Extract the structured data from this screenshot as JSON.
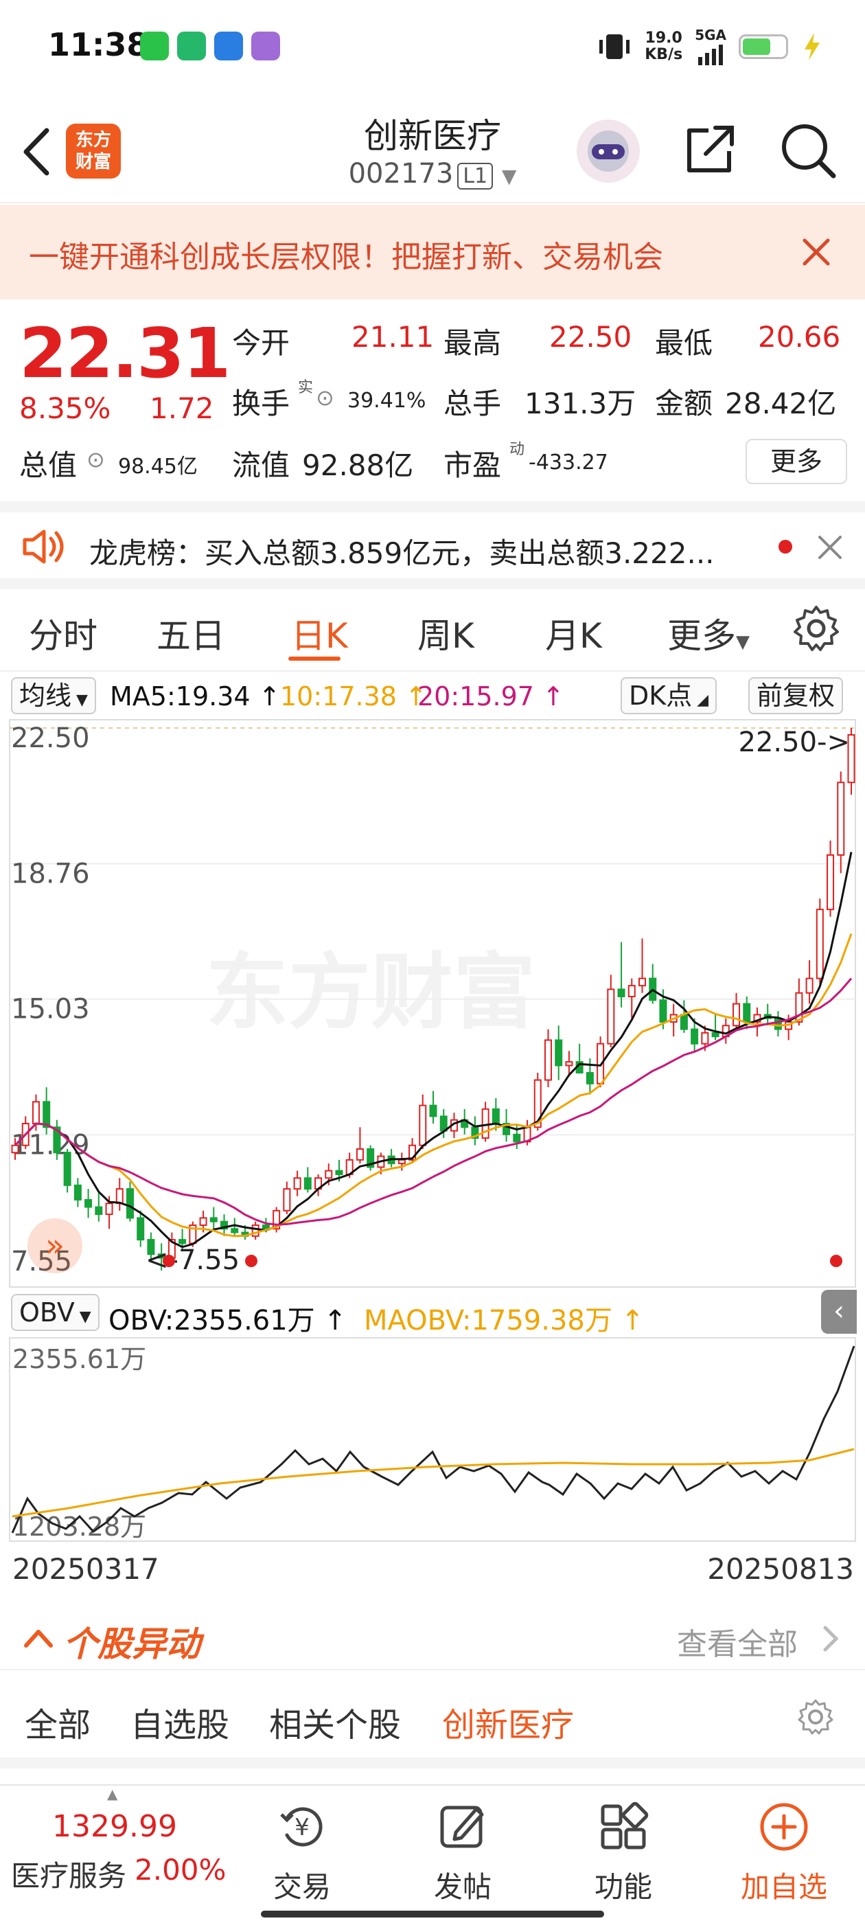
{
  "status_bar": {
    "time": "11:38",
    "net_speed": "19.0",
    "net_unit": "KB/s",
    "network": "5GA"
  },
  "header": {
    "stock_name": "创新医疗",
    "stock_code": "002173",
    "level_badge": "L1",
    "logo_line1": "东方",
    "logo_line2": "财富"
  },
  "promo": {
    "text": "一键开通科创成长层权限！把握打新、交易机会"
  },
  "quote": {
    "price": "22.31",
    "change_pct": "8.35%",
    "change": "1.72",
    "open_label": "今开",
    "open": "21.11",
    "high_label": "最高",
    "high": "22.50",
    "low_label": "最低",
    "low": "20.66",
    "turnover_label": "换手",
    "turnover_sup": "实",
    "turnover": "39.41%",
    "volume_label": "总手",
    "volume": "131.3万",
    "amount_label": "金额",
    "amount": "28.42亿",
    "mktcap_label": "总值",
    "mktcap": "98.45亿",
    "float_label": "流值",
    "float_cap": "92.88亿",
    "pe_label": "市盈",
    "pe_sup": "动",
    "pe": "-433.27",
    "more_label": "更多"
  },
  "dragon_tiger": {
    "text": "龙虎榜：买入总额3.859亿元，卖出总额3.222..."
  },
  "period_tabs": [
    "分时",
    "五日",
    "日K",
    "周K",
    "月K",
    "更多"
  ],
  "ma_row": {
    "selector": "均线",
    "ma5": "MA5:19.34",
    "ma10": "10:17.38",
    "ma20": "20:15.97",
    "dk": "DK点",
    "adjust": "前复权"
  },
  "kline": {
    "y_labels": [
      "22.50",
      "18.76",
      "15.03",
      "11.29",
      "7.55"
    ],
    "max_marker": "22.50->",
    "min_marker": "<-7.55",
    "watermark": "东方财富"
  },
  "obv": {
    "selector": "OBV",
    "obv_value": "OBV:2355.61万",
    "maobv_value": "MAOBV:1759.38万",
    "max_label": "2355.61万",
    "min_label": "1203.28万"
  },
  "dates": {
    "start": "20250317",
    "end": "20250813"
  },
  "movement": {
    "title": "个股异动",
    "view_all": "查看全部",
    "tabs": [
      "全部",
      "自选股",
      "相关个股",
      "创新医疗"
    ]
  },
  "bottom_nav": {
    "index_value": "1329.99",
    "index_name": "医疗服务",
    "index_change": "2.00%",
    "items": [
      "交易",
      "发帖",
      "功能",
      "加自选"
    ]
  },
  "colors": {
    "up": "#e02020",
    "down": "#16a33a",
    "accent": "#ef5a1f",
    "ma5": "#111111",
    "ma10": "#f0a500",
    "ma20": "#c8187a"
  },
  "chart_data": {
    "type": "candlestick",
    "x_range": [
      "20250317",
      "20250813"
    ],
    "y_range": [
      7.55,
      22.5
    ],
    "ohlc": [
      [
        10.8,
        11.2,
        10.6,
        11.0
      ],
      [
        11.0,
        11.8,
        10.9,
        11.6
      ],
      [
        11.6,
        12.4,
        11.4,
        12.2
      ],
      [
        12.2,
        12.6,
        11.3,
        11.5
      ],
      [
        11.5,
        11.7,
        10.6,
        10.8
      ],
      [
        10.8,
        10.9,
        9.7,
        9.9
      ],
      [
        9.9,
        10.1,
        9.3,
        9.5
      ],
      [
        9.5,
        9.8,
        9.0,
        9.3
      ],
      [
        9.3,
        9.7,
        8.9,
        9.1
      ],
      [
        9.1,
        9.6,
        8.7,
        9.4
      ],
      [
        9.4,
        10.1,
        9.2,
        9.8
      ],
      [
        9.8,
        10.0,
        8.9,
        9.0
      ],
      [
        9.0,
        9.2,
        8.2,
        8.4
      ],
      [
        8.4,
        8.6,
        7.8,
        8.0
      ],
      [
        8.0,
        8.3,
        7.55,
        7.9
      ],
      [
        7.9,
        8.6,
        7.8,
        8.4
      ],
      [
        8.4,
        8.7,
        8.1,
        8.3
      ],
      [
        8.3,
        8.9,
        8.2,
        8.8
      ],
      [
        8.8,
        9.2,
        8.6,
        9.0
      ],
      [
        9.0,
        9.3,
        8.7,
        8.9
      ],
      [
        8.9,
        9.1,
        8.5,
        8.7
      ],
      [
        8.7,
        9.0,
        8.5,
        8.6
      ],
      [
        8.6,
        8.8,
        8.4,
        8.5
      ],
      [
        8.5,
        8.9,
        8.4,
        8.8
      ],
      [
        8.8,
        9.0,
        8.6,
        8.7
      ],
      [
        8.7,
        9.3,
        8.6,
        9.2
      ],
      [
        9.2,
        10.0,
        9.1,
        9.8
      ],
      [
        9.8,
        10.3,
        9.6,
        10.1
      ],
      [
        10.1,
        10.4,
        9.7,
        9.8
      ],
      [
        9.8,
        10.2,
        9.6,
        10.1
      ],
      [
        10.1,
        10.5,
        9.9,
        10.3
      ],
      [
        10.3,
        10.6,
        10.0,
        10.2
      ],
      [
        10.2,
        10.8,
        10.1,
        10.6
      ],
      [
        10.6,
        11.5,
        10.5,
        10.9
      ],
      [
        10.9,
        11.0,
        10.3,
        10.4
      ],
      [
        10.4,
        10.8,
        10.2,
        10.7
      ],
      [
        10.7,
        10.9,
        10.4,
        10.5
      ],
      [
        10.5,
        10.8,
        10.3,
        10.6
      ],
      [
        10.6,
        11.2,
        10.5,
        11.0
      ],
      [
        11.0,
        12.4,
        10.9,
        12.1
      ],
      [
        12.1,
        12.5,
        11.6,
        11.8
      ],
      [
        11.8,
        12.0,
        11.2,
        11.4
      ],
      [
        11.4,
        11.9,
        11.2,
        11.7
      ],
      [
        11.7,
        12.0,
        11.3,
        11.5
      ],
      [
        11.5,
        11.8,
        11.0,
        11.2
      ],
      [
        11.2,
        12.2,
        11.1,
        12.0
      ],
      [
        12.0,
        12.3,
        11.4,
        11.6
      ],
      [
        11.6,
        12.0,
        11.1,
        11.3
      ],
      [
        11.3,
        11.6,
        10.9,
        11.1
      ],
      [
        11.1,
        11.7,
        11.0,
        11.5
      ],
      [
        11.5,
        13.0,
        11.4,
        12.8
      ],
      [
        12.8,
        14.2,
        12.6,
        13.9
      ],
      [
        13.9,
        14.3,
        12.8,
        13.2
      ],
      [
        13.2,
        13.6,
        12.9,
        13.3
      ],
      [
        13.3,
        13.8,
        13.0,
        13.0
      ],
      [
        13.0,
        13.4,
        12.4,
        12.7
      ],
      [
        12.7,
        14.0,
        12.6,
        13.8
      ],
      [
        13.8,
        15.7,
        13.7,
        15.3
      ],
      [
        15.3,
        16.6,
        14.8,
        15.1
      ],
      [
        15.1,
        15.6,
        14.5,
        15.4
      ],
      [
        15.4,
        16.7,
        15.2,
        15.6
      ],
      [
        15.6,
        16.0,
        14.9,
        15.0
      ],
      [
        15.0,
        15.3,
        14.2,
        14.4
      ],
      [
        14.4,
        14.9,
        14.0,
        14.6
      ],
      [
        14.6,
        15.0,
        14.1,
        14.2
      ],
      [
        14.2,
        14.5,
        13.6,
        13.8
      ],
      [
        13.8,
        14.3,
        13.6,
        14.1
      ],
      [
        14.1,
        14.6,
        13.9,
        14.0
      ],
      [
        14.0,
        14.5,
        13.8,
        14.3
      ],
      [
        14.3,
        15.2,
        14.2,
        14.9
      ],
      [
        14.9,
        15.1,
        14.2,
        14.4
      ],
      [
        14.4,
        14.8,
        14.0,
        14.6
      ],
      [
        14.6,
        14.9,
        14.3,
        14.5
      ],
      [
        14.5,
        14.7,
        14.0,
        14.2
      ],
      [
        14.2,
        14.6,
        13.9,
        14.4
      ],
      [
        14.4,
        15.6,
        14.3,
        15.2
      ],
      [
        15.2,
        16.1,
        14.9,
        15.6
      ],
      [
        15.6,
        17.8,
        15.4,
        17.5
      ],
      [
        17.5,
        19.4,
        17.3,
        19.0
      ],
      [
        19.0,
        21.3,
        18.5,
        21.0
      ],
      [
        21.0,
        22.5,
        20.66,
        22.31
      ]
    ],
    "ma5": {
      "value": 19.34
    },
    "ma10": {
      "value": 17.38
    },
    "ma20": {
      "value": 15.97
    },
    "obv": {
      "last": 2355.61,
      "maobv_last": 1759.38,
      "range": [
        1203.28,
        2355.61
      ],
      "unit": "万"
    }
  }
}
